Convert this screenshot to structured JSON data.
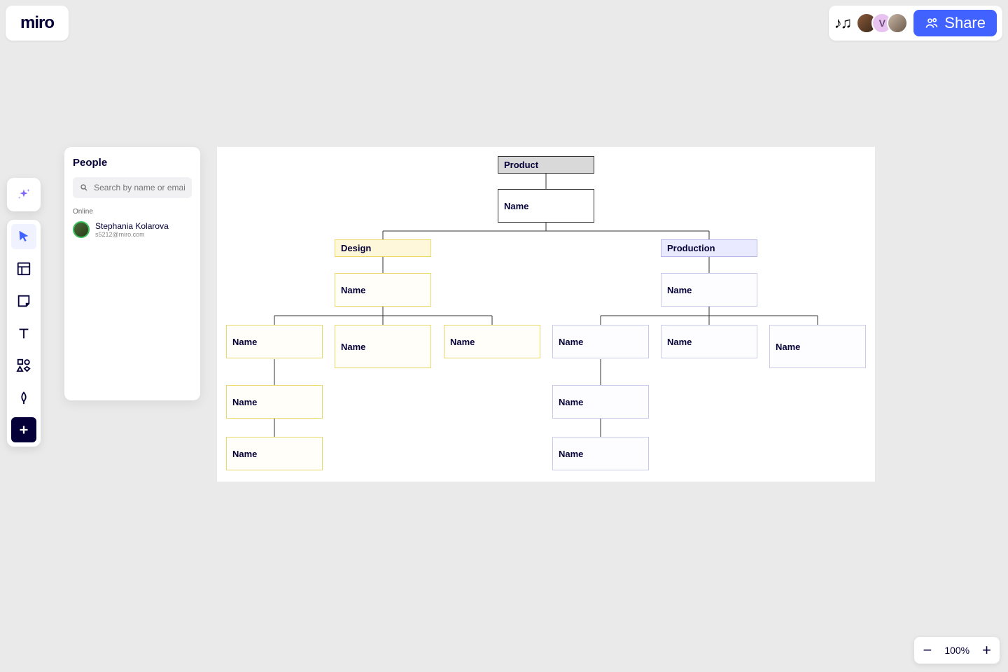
{
  "brand": "miro",
  "header": {
    "share_label": "Share",
    "avatar2_letter": "V"
  },
  "people_panel": {
    "title": "People",
    "search_placeholder": "Search by name or email",
    "section_online": "Online",
    "person": {
      "name": "Stephania Kolarova",
      "email": "s5212@miro.com"
    }
  },
  "zoom": {
    "level": "100%"
  },
  "nodes": {
    "root": "Product",
    "root_name": "Name",
    "design": "Design",
    "design_name": "Name",
    "d_child1": "Name",
    "d_child2": "Name",
    "d_child3": "Name",
    "d_sub1": "Name",
    "d_sub2": "Name",
    "production": "Production",
    "production_name": "Name",
    "p_child1": "Name",
    "p_child2": "Name",
    "p_child3": "Name",
    "p_sub1": "Name",
    "p_sub2": "Name"
  }
}
